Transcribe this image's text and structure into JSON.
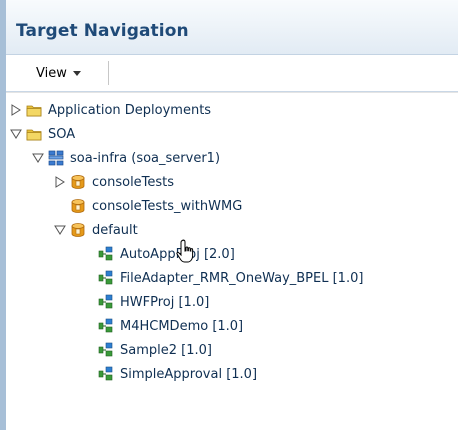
{
  "header": {
    "title": "Target Navigation"
  },
  "toolbar": {
    "view_label": "View"
  },
  "tree": {
    "application_deployments": "Application Deployments",
    "soa": "SOA",
    "soa_infra": "soa-infra (soa_server1)",
    "console_tests": "consoleTests",
    "console_tests_wmg": "consoleTests_withWMG",
    "default": "default",
    "composites": [
      "AutoAppProj [2.0]",
      "FileAdapter_RMR_OneWay_BPEL [1.0]",
      "HWFProj [1.0]",
      "M4HCMDemo [1.0]",
      "Sample2 [1.0]",
      "SimpleApproval [1.0]"
    ]
  },
  "colors": {
    "title": "#1f4a78",
    "header_bg": "#e2ebf4",
    "left_bar": "#a7bfd7",
    "folder": "#e8c13a",
    "partition": "#e59a1a",
    "composite": "#2a8a2a"
  }
}
